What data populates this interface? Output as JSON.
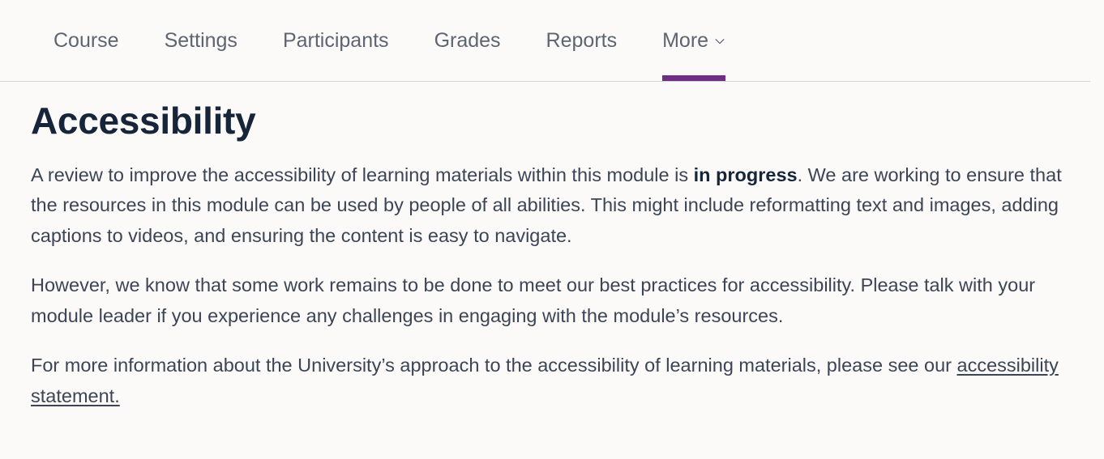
{
  "nav": {
    "items": [
      {
        "label": "Course",
        "active": false
      },
      {
        "label": "Settings",
        "active": false
      },
      {
        "label": "Participants",
        "active": false
      },
      {
        "label": "Grades",
        "active": false
      },
      {
        "label": "Reports",
        "active": false
      },
      {
        "label": "More",
        "active": true,
        "icon": "chevron-down-icon"
      }
    ],
    "active_indicator_color": "#702d84",
    "divider_color": "#ced4da"
  },
  "main": {
    "title": "Accessibility",
    "paragraphs": {
      "p1_before": "A review to improve the accessibility of learning materials within this module is ",
      "p1_bold": "in progress",
      "p1_after": ". We are working to ensure that the resources in this module can be used by people of all abilities. This might include reformatting text and images, adding captions to videos, and ensuring the content is easy to navigate.",
      "p2": "However, we know that some work remains to be done to meet our best practices for accessibility. Please talk with your module leader if you experience any challenges in engaging with the module’s resources.",
      "p3_before": "For more information about the University’s approach to the accessibility of learning materials, please see our ",
      "p3_link": "accessibility statement."
    }
  },
  "colors": {
    "background": "#fbfaf8",
    "heading": "#16253a",
    "body": "#3b4555",
    "nav_text": "#5e6572",
    "accent": "#702d84"
  }
}
